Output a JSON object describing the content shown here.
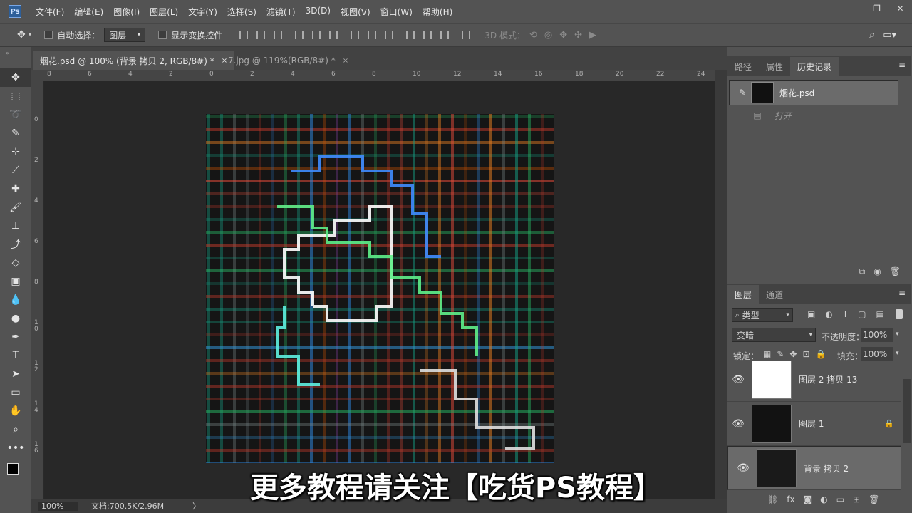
{
  "app": {
    "logo": "Ps",
    "menu": [
      "文件(F)",
      "编辑(E)",
      "图像(I)",
      "图层(L)",
      "文字(Y)",
      "选择(S)",
      "滤镜(T)",
      "3D(D)",
      "视图(V)",
      "窗口(W)",
      "帮助(H)"
    ]
  },
  "options": {
    "auto_select_label": "自动选择：",
    "auto_select_value": "图层",
    "show_transform_label": "显示变换控件",
    "mode_3d_label": "3D 模式："
  },
  "tabs": [
    {
      "label": "烟花.psd @ 100% (背景 拷贝 2, RGB/8#) *",
      "close": "×"
    },
    {
      "label": "7.jpg @ 119%(RGB/8#) *",
      "close": "×"
    }
  ],
  "ruler": {
    "h_ticks": [
      "8",
      "6",
      "4",
      "2",
      "0",
      "2",
      "4",
      "6",
      "8",
      "10",
      "12",
      "14",
      "16",
      "18",
      "20",
      "22",
      "24"
    ],
    "v_ticks": [
      "0",
      "2",
      "4",
      "6",
      "8",
      "1\n0",
      "1\n2",
      "1\n4",
      "1\n6"
    ]
  },
  "status": {
    "zoom": "100%",
    "doc_info": "文档:700.5K/2.96M",
    "arrow": "〉"
  },
  "history_panel": {
    "tabs": [
      "路径",
      "属性",
      "历史记录"
    ],
    "active_tab": "历史记录",
    "snapshot_name": "烟花.psd",
    "items": [
      {
        "label": "打开"
      }
    ]
  },
  "layers_panel": {
    "tabs": [
      "图层",
      "通道"
    ],
    "active_tab": "图层",
    "filter_label": "类型",
    "blend_mode": "变暗",
    "opacity_label": "不透明度：",
    "opacity_value": "100%",
    "lock_label": "锁定：",
    "fill_label": "填充：",
    "fill_value": "100%",
    "layers": [
      {
        "name": "图层 2 拷贝 13",
        "visible": true,
        "locked": false,
        "selected": false
      },
      {
        "name": "图层 1",
        "visible": true,
        "locked": true,
        "selected": false
      },
      {
        "name": "背景 拷贝 2",
        "visible": true,
        "locked": false,
        "selected": true
      }
    ]
  },
  "subtitle": "更多教程请关注【吃货PS教程】",
  "colors": {
    "accent": "#2d5f9a",
    "panel_bg": "#535353",
    "canvas_bg": "#282828"
  }
}
